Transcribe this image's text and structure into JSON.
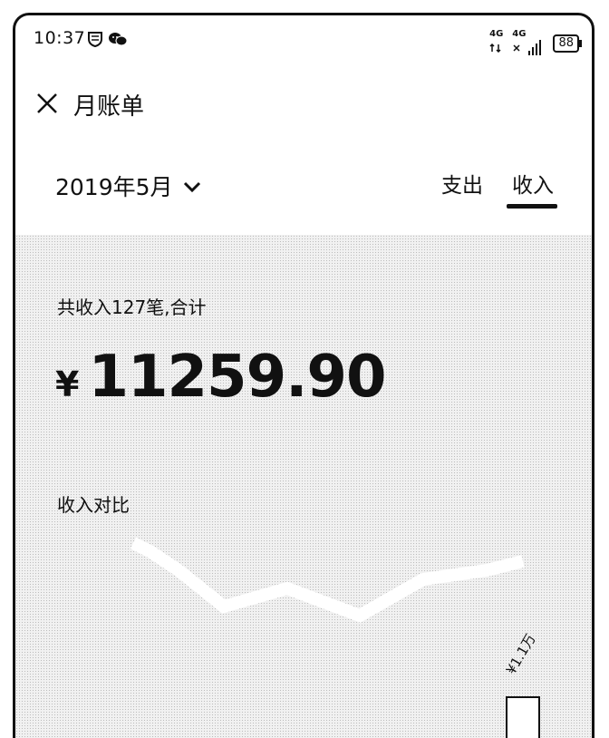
{
  "status_bar": {
    "time": "10:37",
    "network_1": "4G",
    "network_2": "4G",
    "battery": "88"
  },
  "header": {
    "title": "月账单"
  },
  "month": {
    "label": "2019年5月"
  },
  "tabs": [
    {
      "label": "支出",
      "active": false
    },
    {
      "label": "收入",
      "active": true
    }
  ],
  "summary": {
    "label": "共收入127笔,合计",
    "currency": "¥",
    "amount": "11259.90"
  },
  "compare": {
    "title": "收入对比"
  },
  "chart_data": {
    "type": "bar",
    "categories": [
      "",
      "",
      "",
      "",
      "",
      ""
    ],
    "values": [
      0,
      0,
      0,
      0,
      0,
      11259.9
    ],
    "data_labels": [
      "",
      "",
      "",
      "",
      "",
      "¥1.1万"
    ],
    "title": "",
    "xlabel": "",
    "ylabel": ""
  },
  "colors": {
    "text": "#111111",
    "background": "#ffffff",
    "panel": "#f1f1f1"
  }
}
